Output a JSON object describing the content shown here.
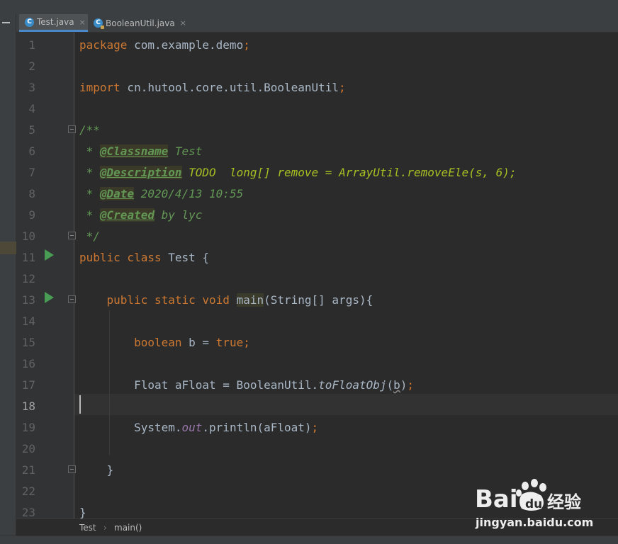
{
  "tabs": [
    {
      "label": "Test.java",
      "icon": "java-class-icon",
      "active": true
    },
    {
      "label": "BooleanUtil.java",
      "icon": "java-class-readonly-icon",
      "active": false
    }
  ],
  "tab_close_glyph": "×",
  "line_numbers": [
    "1",
    "2",
    "3",
    "4",
    "5",
    "6",
    "7",
    "8",
    "9",
    "10",
    "11",
    "12",
    "13",
    "14",
    "15",
    "16",
    "17",
    "18",
    "19",
    "20",
    "21",
    "22",
    "23"
  ],
  "current_line": "18",
  "code": {
    "l1": {
      "kw": "package",
      "rest": " com.example.demo",
      "semi": ";"
    },
    "l3": {
      "kw": "import",
      "rest": " cn.hutool.core.util.BooleanUtil",
      "semi": ";"
    },
    "l5": {
      "text": "/**"
    },
    "l6": {
      "star": " * ",
      "tag": "@Classname",
      "text": " Test"
    },
    "l7": {
      "star": " * ",
      "tag": "@Description",
      "todo": " TODO",
      "text": "  long[] remove = ArrayUtil.removeEle(s, 6);"
    },
    "l8": {
      "star": " * ",
      "tag": "@Date",
      "text": " 2020/4/13 10:55"
    },
    "l9": {
      "star": " * ",
      "tag": "@Created",
      "text": " by lyc"
    },
    "l10": {
      "text": " */"
    },
    "l11": {
      "kw": "public class",
      "rest": " Test {"
    },
    "l13": {
      "indent": "    ",
      "kw": "public static void",
      "space": " ",
      "method": "main",
      "rest": "(String[] args){"
    },
    "l15": {
      "indent": "        ",
      "kw": "boolean",
      "mid": " b = ",
      "kw2": "true",
      "semi": ";"
    },
    "l17": {
      "indent": "        ",
      "a": "Float aFloat = BooleanUtil.",
      "call": "toFloatObj",
      "open": "(",
      "arg": "b",
      "close": ")",
      "semi": ";"
    },
    "l19": {
      "indent": "        ",
      "a": "System.",
      "field": "out",
      "b": ".println(aFloat)",
      "semi": ";"
    },
    "l21": {
      "indent": "    ",
      "text": "}"
    },
    "l23": {
      "text": "}"
    }
  },
  "breadcrumb": {
    "class": "Test",
    "sep": "›",
    "method": "main()"
  },
  "watermark": {
    "logo": "Bai du 经验",
    "text": "jingyan.baidu.com"
  }
}
